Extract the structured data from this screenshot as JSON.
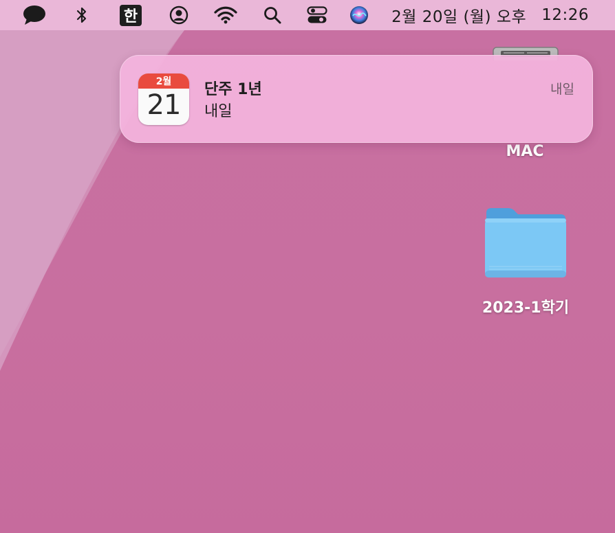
{
  "menubar": {
    "icons": [
      "messages-icon",
      "bluetooth-icon",
      "input-source-icon",
      "user-account-icon",
      "wifi-icon",
      "spotlight-search-icon",
      "control-center-icon",
      "siri-icon"
    ],
    "input_source": "한",
    "date": "2월 20일 (월) 오후",
    "time": "12:26"
  },
  "notification": {
    "app_icon": "calendar-icon",
    "calendar_month": "2월",
    "calendar_day": "21",
    "title": "단주 1년",
    "body": "내일",
    "time": "내일"
  },
  "desktop": {
    "items": [
      {
        "label": "MAC",
        "icon": "hard-drive-icon"
      },
      {
        "label": "2023-1학기",
        "icon": "folder-icon"
      }
    ]
  },
  "colors": {
    "wallpaper": "#c870a2",
    "menubar": "#eab7d8",
    "notification": "#f4b4de",
    "calendar_red": "#e94b3e",
    "folder_blue": "#7cc8f5"
  }
}
